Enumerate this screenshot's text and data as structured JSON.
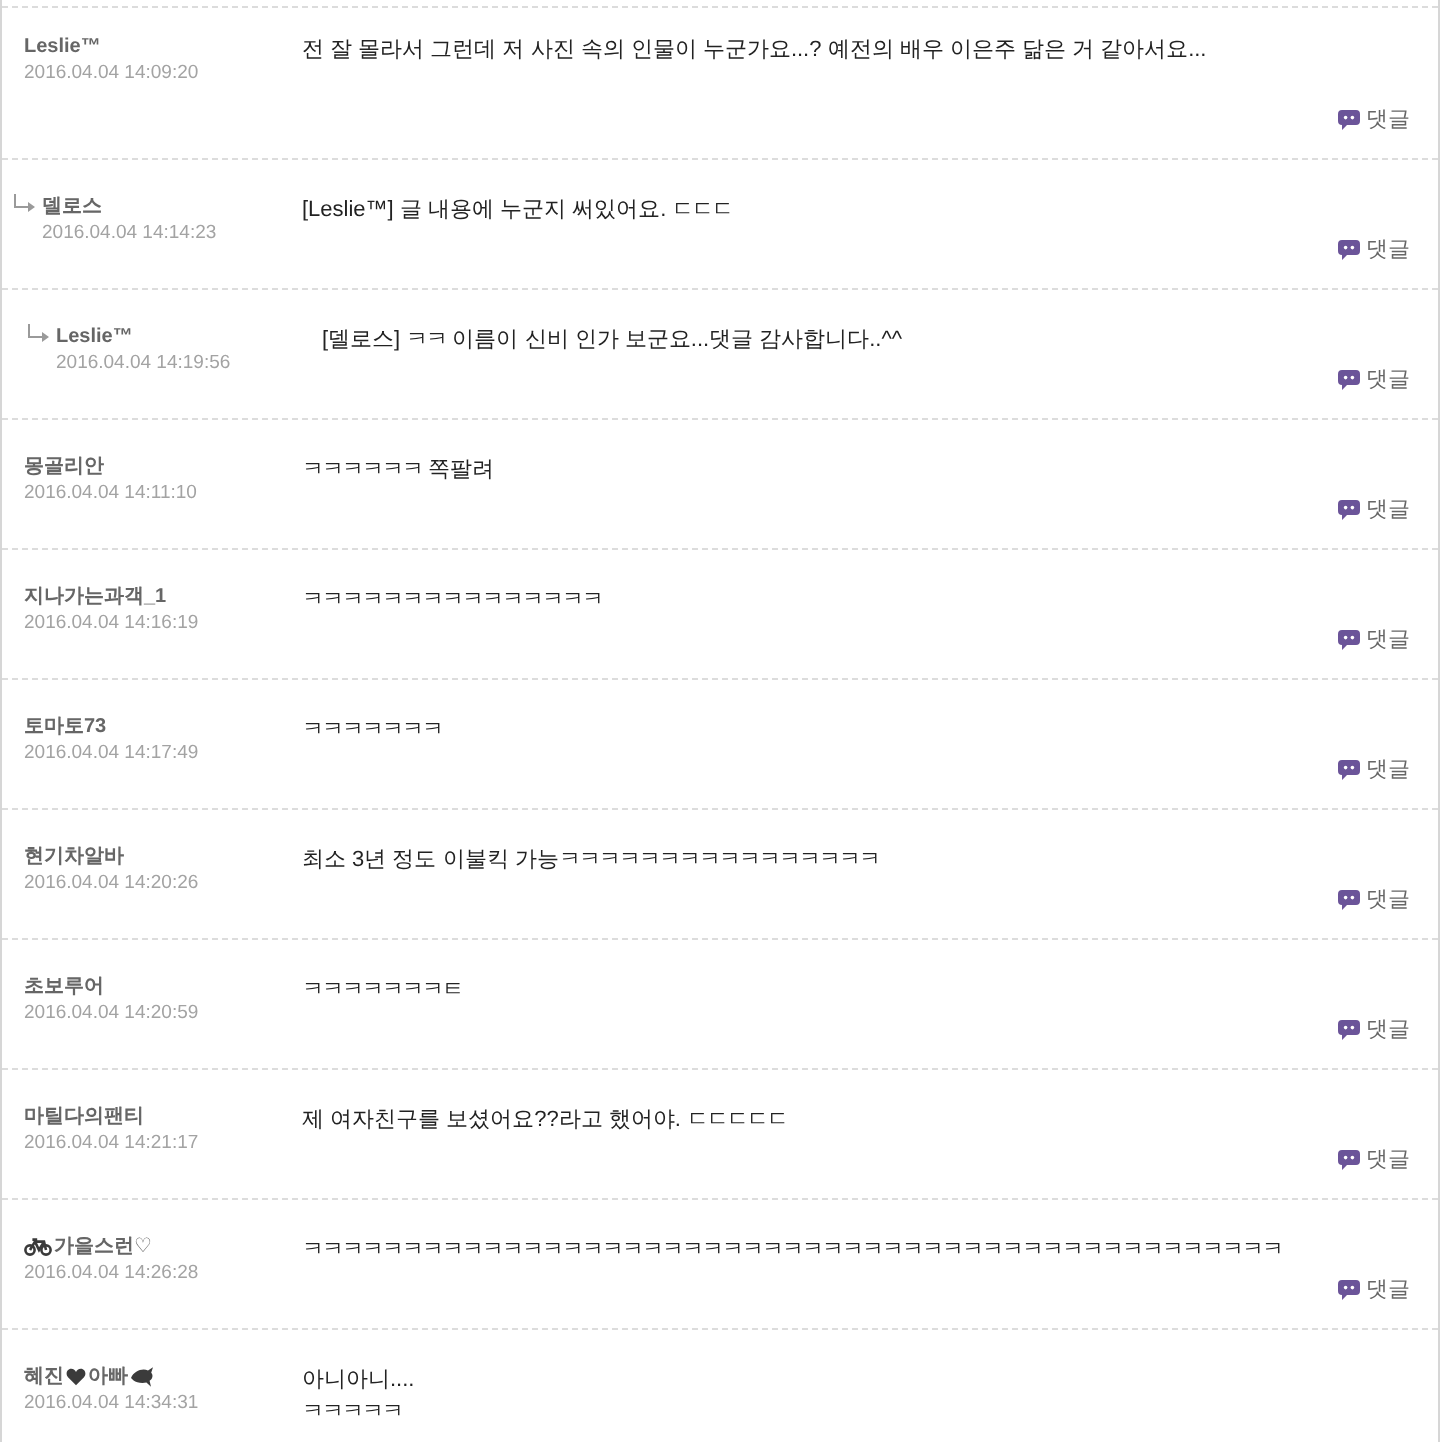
{
  "comments": [
    {
      "author": "Leslie™",
      "date": "2016.04.04 14:09:20",
      "text": "전 잘 몰라서 그런데 저 사진 속의 인물이 누군가요...? 예전의 배우 이은주 닮은 거 같아서요...",
      "reply_label": "댓글",
      "children": [
        {
          "author": "델로스",
          "date": "2016.04.04 14:14:23",
          "text": "[Leslie™] 글 내용에 누군지 써있어요. ㄷㄷㄷ",
          "reply_label": "댓글",
          "children": [
            {
              "author": "Leslie™",
              "date": "2016.04.04 14:19:56",
              "text": "[델로스] ㅋㅋ 이름이 신비 인가 보군요...댓글 감사합니다..^^",
              "reply_label": "댓글"
            }
          ]
        }
      ]
    },
    {
      "author": "몽골리안",
      "date": "2016.04.04 14:11:10",
      "text": "ㅋㅋㅋㅋㅋㅋ 쪽팔려",
      "reply_label": "댓글"
    },
    {
      "author": "지나가는과객_1",
      "date": "2016.04.04 14:16:19",
      "text": "ㅋㅋㅋㅋㅋㅋㅋㅋㅋㅋㅋㅋㅋㅋㅋ",
      "reply_label": "댓글"
    },
    {
      "author": "토마토73",
      "date": "2016.04.04 14:17:49",
      "text": "ㅋㅋㅋㅋㅋㅋㅋ",
      "reply_label": "댓글"
    },
    {
      "author": "현기차알바",
      "date": "2016.04.04 14:20:26",
      "text": "최소 3년 정도 이불킥 가능ㅋㅋㅋㅋㅋㅋㅋㅋㅋㅋㅋㅋㅋㅋㅋㅋ",
      "reply_label": "댓글"
    },
    {
      "author": "초보루어",
      "date": "2016.04.04 14:20:59",
      "text": "ㅋㅋㅋㅋㅋㅋㅋㅌ",
      "reply_label": "댓글"
    },
    {
      "author": "마틸다의팬티",
      "date": "2016.04.04 14:21:17",
      "text": "제 여자친구를 보셨어요??라고 했어야. ㄷㄷㄷㄷㄷ",
      "reply_label": "댓글"
    },
    {
      "author": [
        {
          "kind": "bicycle"
        },
        {
          "kind": "text",
          "text": "가을스런♡"
        }
      ],
      "date": "2016.04.04 14:26:28",
      "text": "ㅋㅋㅋㅋㅋㅋㅋㅋㅋㅋㅋㅋㅋㅋㅋㅋㅋㅋㅋㅋㅋㅋㅋㅋㅋㅋㅋㅋㅋㅋㅋㅋㅋㅋㅋㅋㅋㅋㅋㅋㅋㅋㅋㅋㅋㅋㅋㅋㅋ",
      "reply_label": "댓글"
    },
    {
      "author": [
        {
          "kind": "text",
          "text": "혜진"
        },
        {
          "kind": "heart"
        },
        {
          "kind": "text",
          "text": "아빠"
        },
        {
          "kind": "fish"
        }
      ],
      "date": "2016.04.04 14:34:31",
      "text": "아니아니....\nㅋㅋㅋㅋㅋ"
    }
  ]
}
